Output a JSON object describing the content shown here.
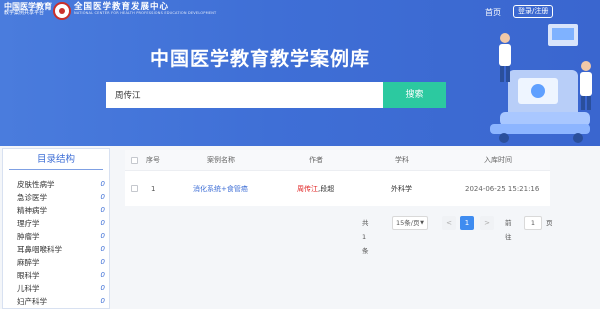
{
  "brand": {
    "logo1_line1": "中国医学教育",
    "logo1_line2": "教学案例共享平台",
    "logo3_line1": "全国医学教育发展中心",
    "logo3_line2": "NATIONAL CENTER FOR HEALTH PROFESSIONS EDUCATION DEVELOPMENT"
  },
  "nav": {
    "home": "首页",
    "login": "登录/注册"
  },
  "hero": {
    "title": "中国医学教育教学案例库"
  },
  "search": {
    "value": "周传江",
    "button": "搜索"
  },
  "sidebar": {
    "title": "目录结构",
    "items": [
      {
        "label": "皮肤性病学",
        "count": "0"
      },
      {
        "label": "急诊医学",
        "count": "0"
      },
      {
        "label": "精神病学",
        "count": "0"
      },
      {
        "label": "理疗学",
        "count": "0"
      },
      {
        "label": "肿瘤学",
        "count": "0"
      },
      {
        "label": "耳鼻咽喉科学",
        "count": "0"
      },
      {
        "label": "麻醉学",
        "count": "0"
      },
      {
        "label": "眼科学",
        "count": "0"
      },
      {
        "label": "儿科学",
        "count": "0"
      },
      {
        "label": "妇产科学",
        "count": "0"
      }
    ]
  },
  "table": {
    "headers": {
      "index": "序号",
      "name": "案例名称",
      "author": "作者",
      "subject": "学科",
      "time": "入库时间"
    },
    "rows": [
      {
        "index": "1",
        "name": "消化系统+食管癌",
        "author_highlight": "周传江",
        "author_rest": ",段超",
        "subject": "外科学",
        "time": "2024-06-25 15:21:16"
      }
    ]
  },
  "pager": {
    "total": "共 1 条",
    "page_size": "15条/页",
    "prev": "<",
    "page": "1",
    "next": ">",
    "goto": "前往",
    "goto_value": "1",
    "unit": "页"
  },
  "colors": {
    "primary": "#3f6fd6",
    "accent": "#2cc9a0",
    "highlight": "#e02020"
  }
}
